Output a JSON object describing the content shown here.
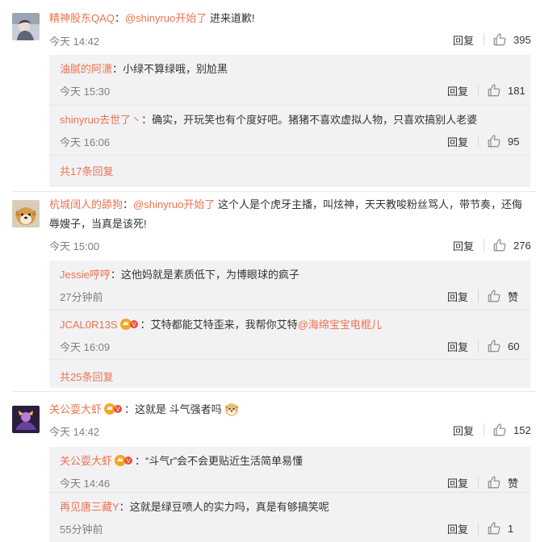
{
  "colors": {
    "accent": "#eb7350",
    "text": "#333333",
    "muted": "#808080",
    "sub_bg": "#f2f2f5"
  },
  "comments": [
    {
      "user": "精神股东QAQ",
      "colon": "：",
      "mention": "@shinyruo开始了",
      "text": " 进来道歉!",
      "time": "今天 14:42",
      "reply_label": "回复",
      "likes": "395",
      "replies": [
        {
          "user": "油腻的阿潇",
          "colon": "：",
          "text": "小绿不算绿哦，别尬黑",
          "time": "今天 15:30",
          "reply_label": "回复",
          "likes": "181"
        },
        {
          "user": "shinyruo去世了丶",
          "colon": "：",
          "text": "确实，开玩笑也有个度好吧。猪猪不喜欢虚拟人物，只喜欢搞别人老婆",
          "time": "今天 16:06",
          "reply_label": "回复",
          "likes": "95"
        }
      ],
      "more": "共17条回复"
    },
    {
      "user": "杭城阔人的舔狗",
      "colon": "：",
      "mention": "@shinyruo开始了",
      "text": " 这个人是个虎牙主播，叫炫神，天天教唆粉丝骂人，带节奏，还侮辱嫂子，当真是该死!",
      "time": "今天 15:00",
      "reply_label": "回复",
      "likes": "276",
      "replies": [
        {
          "user": "Jessie哼哼",
          "colon": "：",
          "text": "这他妈就是素质低下，为博眼球的疯子",
          "time": "27分钟前",
          "reply_label": "回复",
          "likes": "赞"
        },
        {
          "user": "JCAL0R13S",
          "colon": "：",
          "text": "艾特都能艾特歪来，我帮你艾特",
          "mention": "@海绵宝宝电棍儿",
          "time": "今天 16:09",
          "reply_label": "回复",
          "likes": "60"
        }
      ],
      "more": "共25条回复"
    },
    {
      "user": "关公耍大虾",
      "colon": "：",
      "text": "这就是  斗气强者吗",
      "time": "今天 14:42",
      "reply_label": "回复",
      "likes": "152",
      "replies": [
        {
          "user": "关公耍大虾",
          "colon": "：",
          "text": "“斗气r”会不会更贴近生活简单易懂",
          "time": "今天 14:46",
          "reply_label": "回复",
          "likes": "赞"
        },
        {
          "user": "再见唐三藏Y",
          "colon": "：",
          "text": "这就是绿豆喷人的实力吗，真是有够搞笑呢",
          "time": "55分钟前",
          "reply_label": "回复",
          "likes": "1"
        }
      ]
    }
  ]
}
